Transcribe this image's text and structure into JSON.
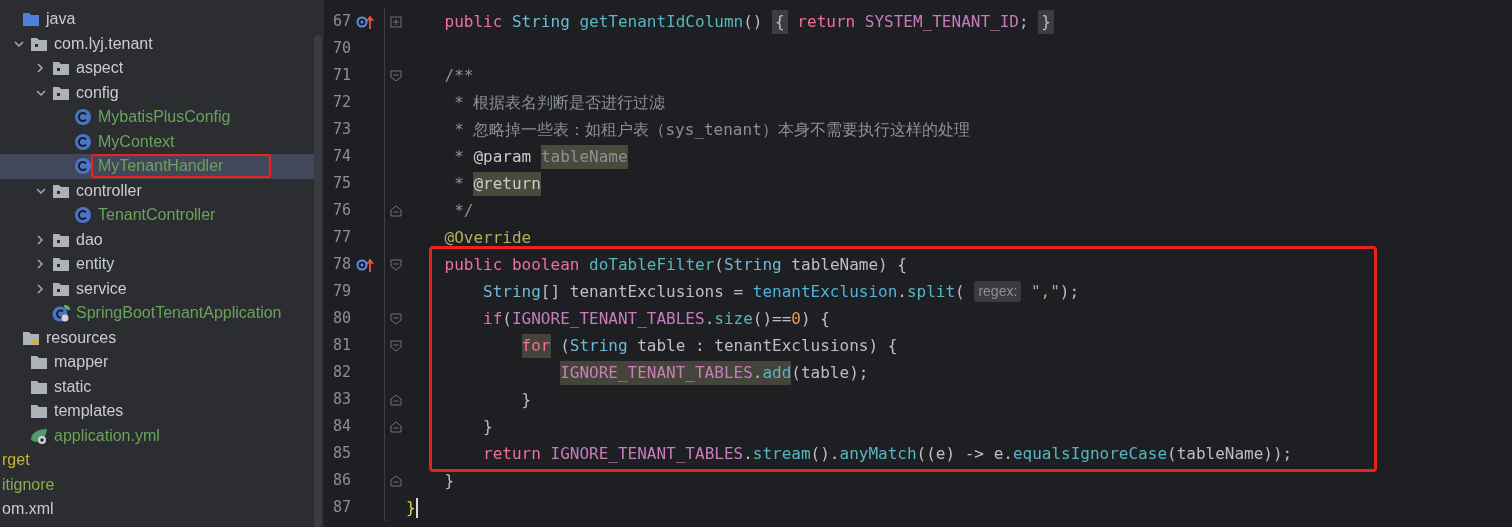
{
  "project_tree": {
    "items": [
      {
        "kind": "source_folder",
        "label": "java",
        "color": "#c9ccd2",
        "selected": false,
        "annotated": false,
        "children": [
          {
            "kind": "package",
            "label": "com.lyj.tenant",
            "color": "#c9ccd2",
            "expanded": true,
            "selected": false,
            "annotated": false,
            "children": [
              {
                "kind": "package",
                "label": "aspect",
                "color": "#c9ccd2",
                "expanded": false,
                "selected": false,
                "annotated": false
              },
              {
                "kind": "package",
                "label": "config",
                "color": "#c9ccd2",
                "expanded": true,
                "selected": false,
                "annotated": false,
                "children": [
                  {
                    "kind": "class",
                    "label": "MybatisPlusConfig",
                    "color": "#6aa35a",
                    "selected": false,
                    "annotated": false
                  },
                  {
                    "kind": "class",
                    "label": "MyContext",
                    "color": "#6aa35a",
                    "selected": false,
                    "annotated": false
                  },
                  {
                    "kind": "class",
                    "label": "MyTenantHandler",
                    "color": "#6aa35a",
                    "selected": true,
                    "annotated": true
                  }
                ]
              },
              {
                "kind": "package",
                "label": "controller",
                "color": "#c9ccd2",
                "expanded": true,
                "selected": false,
                "annotated": false,
                "children": [
                  {
                    "kind": "class",
                    "label": "TenantController",
                    "color": "#6aa35a",
                    "selected": false,
                    "annotated": false
                  }
                ]
              },
              {
                "kind": "package",
                "label": "dao",
                "color": "#c9ccd2",
                "expanded": false,
                "selected": false,
                "annotated": false
              },
              {
                "kind": "package",
                "label": "entity",
                "color": "#c9ccd2",
                "expanded": false,
                "selected": false,
                "annotated": false
              },
              {
                "kind": "package",
                "label": "service",
                "color": "#c9ccd2",
                "expanded": false,
                "selected": false,
                "annotated": false
              },
              {
                "kind": "spring_class",
                "label": "SpringBootTenantApplication",
                "color": "#6aa35a",
                "selected": false,
                "annotated": false
              }
            ]
          }
        ]
      },
      {
        "kind": "resources_folder",
        "label": "resources",
        "color": "#c9ccd2",
        "selected": false,
        "annotated": false,
        "children": [
          {
            "kind": "folder",
            "label": "mapper",
            "color": "#c9ccd2",
            "selected": false,
            "annotated": false
          },
          {
            "kind": "folder",
            "label": "static",
            "color": "#c9ccd2",
            "selected": false,
            "annotated": false
          },
          {
            "kind": "folder",
            "label": "templates",
            "color": "#c9ccd2",
            "selected": false,
            "annotated": false
          },
          {
            "kind": "yaml",
            "label": "application.yml",
            "color": "#6aa35a",
            "selected": false,
            "annotated": false
          }
        ]
      },
      {
        "kind": "clipped",
        "label": "rget",
        "color": "#c8b33a",
        "selected": false,
        "annotated": false
      },
      {
        "kind": "clipped",
        "label": "itignore",
        "color": "#8ea84e",
        "selected": false,
        "annotated": false
      },
      {
        "kind": "clipped",
        "label": "om.xml",
        "color": "#c9ccd2",
        "selected": false,
        "annotated": false
      }
    ]
  },
  "editor": {
    "lines": [
      {
        "number": "67",
        "gutter": {
          "kind": "override"
        },
        "fold": {
          "kind": "collapsed"
        },
        "boxed": false,
        "cursor": false,
        "tokens": [
          {
            "kind": "kw",
            "t": "    public"
          },
          {
            "kind": "type",
            "t": " String"
          },
          {
            "kind": "decl",
            "t": " getTenantIdColumn"
          },
          {
            "kind": "plain",
            "t": "()"
          },
          {
            "kind": "fold",
            "t": " {"
          },
          {
            "kind": "kw",
            "t": " return"
          },
          {
            "kind": "const",
            "t": " SYSTEM_TENANT_ID"
          },
          {
            "kind": "plain",
            "t": ";"
          },
          {
            "kind": "fold",
            "t": " }"
          }
        ]
      },
      {
        "number": "70",
        "boxed": false,
        "cursor": false
      },
      {
        "number": "71",
        "fold": {
          "kind": "start"
        },
        "boxed": false,
        "cursor": false,
        "tokens": [
          {
            "kind": "comment",
            "t": "    /**"
          }
        ]
      },
      {
        "number": "72",
        "boxed": false,
        "cursor": false,
        "tokens": [
          {
            "kind": "comment",
            "t": "     * 根据表名判断是否进行过滤"
          }
        ]
      },
      {
        "number": "73",
        "boxed": false,
        "cursor": false,
        "tokens": [
          {
            "kind": "comment",
            "t": "     * 忽略掉一些表：如租户表（sys_tenant）本身不需要执行这样的处理"
          }
        ]
      },
      {
        "number": "74",
        "boxed": false,
        "cursor": false,
        "tokens": [
          {
            "kind": "comment",
            "t": "     *"
          },
          {
            "kind": "tag",
            "t": " @param"
          },
          {
            "kind": "ref",
            "t": " tableName"
          }
        ]
      },
      {
        "number": "75",
        "boxed": false,
        "cursor": false,
        "tokens": [
          {
            "kind": "comment",
            "t": "     *"
          },
          {
            "kind": "tag_hl",
            "t": " @return"
          }
        ]
      },
      {
        "number": "76",
        "fold": {
          "kind": "end"
        },
        "boxed": false,
        "cursor": false,
        "tokens": [
          {
            "kind": "comment",
            "t": "     */"
          }
        ]
      },
      {
        "number": "77",
        "boxed": false,
        "cursor": false,
        "tokens": [
          {
            "kind": "annotation",
            "t": "    @Override"
          }
        ]
      },
      {
        "number": "78",
        "gutter": {
          "kind": "override"
        },
        "fold": {
          "kind": "start"
        },
        "boxed": true,
        "cursor": false,
        "tokens": [
          {
            "kind": "kw",
            "t": "    public"
          },
          {
            "kind": "kw",
            "t": " boolean"
          },
          {
            "kind": "decl",
            "t": " doTableFilter"
          },
          {
            "kind": "plain",
            "t": "("
          },
          {
            "kind": "type",
            "t": "String"
          },
          {
            "kind": "plain",
            "t": " tableName) {"
          }
        ]
      },
      {
        "number": "79",
        "boxed": true,
        "cursor": false,
        "tokens": [
          {
            "kind": "type",
            "t": "        String"
          },
          {
            "kind": "plain",
            "t": "[] tenantExclusions ="
          },
          {
            "kind": "field",
            "t": " tenantExclusion"
          },
          {
            "kind": "plain",
            "t": "."
          },
          {
            "kind": "call",
            "t": "split"
          },
          {
            "kind": "plain",
            "t": "("
          },
          {
            "kind": "hint",
            "t": " regex:"
          },
          {
            "kind": "string",
            "t": " \",\""
          },
          {
            "kind": "plain",
            "t": ");"
          }
        ]
      },
      {
        "number": "80",
        "fold": {
          "kind": "start"
        },
        "boxed": true,
        "cursor": false,
        "tokens": [
          {
            "kind": "kw",
            "t": "        if"
          },
          {
            "kind": "plain",
            "t": "("
          },
          {
            "kind": "const",
            "t": "IGNORE_TENANT_TABLES"
          },
          {
            "kind": "plain",
            "t": "."
          },
          {
            "kind": "call",
            "t": "size"
          },
          {
            "kind": "plain",
            "t": "()=="
          },
          {
            "kind": "number",
            "t": "0"
          },
          {
            "kind": "plain",
            "t": ") {"
          }
        ]
      },
      {
        "number": "81",
        "fold": {
          "kind": "start"
        },
        "boxed": true,
        "cursor": false,
        "tokens": [
          {
            "kind": "kw_hl",
            "t": "            for"
          },
          {
            "kind": "plain",
            "t": " ("
          },
          {
            "kind": "type",
            "t": "String"
          },
          {
            "kind": "plain",
            "t": " table : tenantExclusions) {"
          }
        ]
      },
      {
        "number": "82",
        "boxed": true,
        "cursor": false,
        "tokens": [
          {
            "kind": "usage_const",
            "t": "                IGNORE_TENANT_TABLES"
          },
          {
            "kind": "usage_plain",
            "t": "."
          },
          {
            "kind": "usage_call",
            "t": "add"
          },
          {
            "kind": "plain",
            "t": "(table);"
          }
        ]
      },
      {
        "number": "83",
        "fold": {
          "kind": "end"
        },
        "boxed": true,
        "cursor": false,
        "tokens": [
          {
            "kind": "plain",
            "t": "            }"
          }
        ]
      },
      {
        "number": "84",
        "fold": {
          "kind": "end"
        },
        "boxed": true,
        "cursor": false,
        "tokens": [
          {
            "kind": "plain",
            "t": "        }"
          }
        ]
      },
      {
        "number": "85",
        "boxed": true,
        "cursor": false,
        "tokens": [
          {
            "kind": "kw",
            "t": "        return"
          },
          {
            "kind": "const",
            "t": " IGNORE_TENANT_TABLES"
          },
          {
            "kind": "plain",
            "t": "."
          },
          {
            "kind": "call",
            "t": "stream"
          },
          {
            "kind": "plain",
            "t": "()."
          },
          {
            "kind": "call",
            "t": "anyMatch"
          },
          {
            "kind": "plain",
            "t": "((e) -> e."
          },
          {
            "kind": "call",
            "t": "equalsIgnoreCase"
          },
          {
            "kind": "plain",
            "t": "(tableName));"
          }
        ]
      },
      {
        "number": "86",
        "fold": {
          "kind": "end"
        },
        "boxed": false,
        "cursor": false,
        "tokens": [
          {
            "kind": "plain",
            "t": "    }"
          }
        ]
      },
      {
        "number": "87",
        "boxed": false,
        "cursor": true,
        "tokens": [
          {
            "kind": "brace_match",
            "t": "}"
          }
        ]
      }
    ]
  }
}
